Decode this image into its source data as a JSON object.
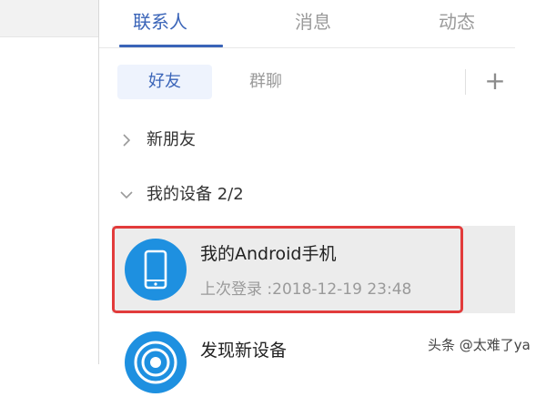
{
  "tabs": [
    {
      "label": "联系人",
      "active": true
    },
    {
      "label": "消息",
      "active": false
    },
    {
      "label": "动态",
      "active": false
    }
  ],
  "subtabs": [
    {
      "label": "好友",
      "active": true
    },
    {
      "label": "群聊",
      "active": false
    }
  ],
  "add_label": "+",
  "groups": {
    "new_friends": {
      "label": "新朋友",
      "icon": "chevron-right-icon"
    },
    "my_devices": {
      "label": "我的设备 2/2",
      "icon": "chevron-down-icon"
    }
  },
  "devices": [
    {
      "name": "我的Android手机",
      "sub": "上次登录 :2018-12-19 23:48",
      "icon": "phone-icon",
      "highlighted": true
    },
    {
      "name": "发现新设备",
      "icon": "signal-icon"
    }
  ],
  "watermark": "头条 @太难了ya",
  "colors": {
    "accent": "#3a64b8",
    "highlight": "#e23b3b",
    "avatar": "#1e90e0"
  }
}
